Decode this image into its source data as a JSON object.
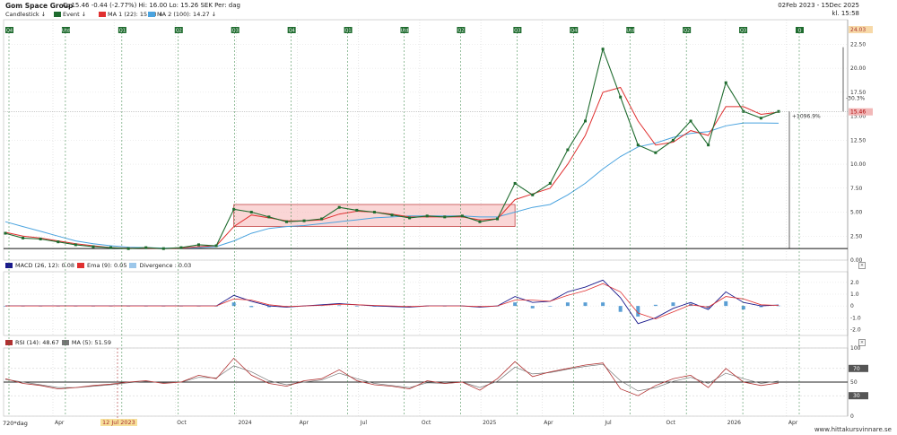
{
  "header": {
    "title": "Gom Space Group",
    "quote": "C: 15.46  -0.44 (-2.77%)   Hi: 16.00   Lo: 15.26   SEK   Per: dag",
    "date_range": "02Feb 2023 - 15Dec 2025",
    "updated": "kl. 15:58",
    "legend": [
      {
        "label": "Candlestick",
        "color": "#1e6b2e"
      },
      {
        "label": "Event",
        "color": "#1e6b2e"
      },
      {
        "label": "MA 1 (22): 15.43",
        "color": "#e03030"
      },
      {
        "label": "MA 2 (100): 14.27",
        "color": "#4aa3df"
      }
    ]
  },
  "panes": {
    "macd_legend": [
      {
        "label": "MACD (26, 12): 0.08",
        "color": "#1a1a8c"
      },
      {
        "label": "Ema (9): 0.05",
        "color": "#e03030"
      },
      {
        "label": "Divergence : 0.03",
        "color": "#9cc7ea"
      }
    ],
    "rsi_legend": [
      {
        "label": "RSI (14): 48.67",
        "color": "#b03030"
      },
      {
        "label": "MA (5): 51.59",
        "color": "#777777"
      }
    ]
  },
  "footer": {
    "period_label": "720*dag",
    "cursor_date": "12 Jul 2023",
    "credit": "www.hittakursvinnare.se"
  },
  "annotations": {
    "drop_pct": "-30.3%",
    "rise_pct": "+1096.9%",
    "current_price": "15.46",
    "top_price": "24.03"
  },
  "colors": {
    "candle_up": "#1e6b2e",
    "candle_down": "#1e6b2e",
    "ma1": "#e03030",
    "ma2": "#4aa3df",
    "range_box": "#f5b5b5",
    "event_marker": "#1e6b2e"
  },
  "chart_data": {
    "type": "line",
    "title": "Gom Space Group",
    "x_ticks": [
      "Apr",
      "Jul",
      "Oct",
      "2024",
      "Apr",
      "Jul",
      "Oct",
      "2025",
      "Apr",
      "Jul",
      "Oct",
      "2026",
      "Apr"
    ],
    "y_ticks": [
      0.0,
      2.5,
      5.0,
      7.5,
      10.0,
      12.5,
      15.0,
      17.5,
      20.0,
      22.5
    ],
    "ylim": [
      0,
      24.5
    ],
    "event_markers": [
      "Q4",
      "Utd",
      "Q1",
      "Q2",
      "Q3",
      "Q4",
      "Q1",
      "Utd",
      "Q2",
      "Q3",
      "Q4",
      "Utd",
      "Q2",
      "Q3",
      "Q"
    ],
    "price": [
      2.8,
      2.3,
      2.2,
      1.9,
      1.6,
      1.4,
      1.3,
      1.2,
      1.3,
      1.2,
      1.3,
      1.6,
      1.5,
      5.3,
      5.0,
      4.5,
      4.0,
      4.1,
      4.3,
      5.5,
      5.2,
      5.0,
      4.7,
      4.4,
      4.6,
      4.5,
      4.6,
      4.0,
      4.3,
      8.0,
      6.8,
      8.0,
      11.5,
      14.5,
      22.0,
      17.0,
      12.0,
      11.2,
      12.5,
      14.5,
      12.0,
      18.5,
      15.5,
      14.8,
      15.5
    ],
    "series": [
      {
        "name": "MA 1 (22)",
        "values": [
          2.9,
          2.5,
          2.3,
          2.0,
          1.7,
          1.5,
          1.3,
          1.25,
          1.25,
          1.2,
          1.25,
          1.4,
          1.5,
          3.5,
          4.7,
          4.4,
          4.1,
          4.1,
          4.2,
          4.8,
          5.1,
          5.0,
          4.8,
          4.5,
          4.5,
          4.5,
          4.5,
          4.2,
          4.3,
          6.3,
          6.9,
          7.5,
          10.0,
          13.0,
          17.5,
          18.0,
          14.5,
          12.0,
          12.3,
          13.5,
          13.0,
          16.0,
          16.0,
          15.2,
          15.43
        ]
      },
      {
        "name": "MA 2 (100)",
        "values": [
          4.0,
          3.5,
          3.0,
          2.5,
          2.0,
          1.7,
          1.5,
          1.35,
          1.3,
          1.25,
          1.25,
          1.3,
          1.4,
          2.0,
          2.8,
          3.3,
          3.5,
          3.6,
          3.8,
          4.0,
          4.2,
          4.4,
          4.5,
          4.6,
          4.6,
          4.6,
          4.6,
          4.5,
          4.5,
          5.0,
          5.5,
          5.8,
          6.8,
          8.0,
          9.5,
          10.8,
          11.8,
          12.2,
          12.8,
          13.2,
          13.4,
          14.0,
          14.3,
          14.3,
          14.27
        ]
      }
    ],
    "range_box": {
      "y": [
        3.5,
        5.8
      ]
    },
    "macd": {
      "yticks": [
        -2.0,
        -1.0,
        0,
        1.0,
        2.0
      ],
      "ylim": [
        -2.2,
        2.6
      ],
      "macd": [
        0,
        0,
        0,
        0,
        0,
        0,
        0,
        0,
        0,
        0,
        0,
        0,
        0,
        0.9,
        0.4,
        0.0,
        -0.1,
        0,
        0.1,
        0.2,
        0.1,
        0.0,
        -0.05,
        -0.1,
        0,
        0,
        0,
        -0.1,
        0,
        0.8,
        0.3,
        0.4,
        1.2,
        1.6,
        2.2,
        0.7,
        -1.5,
        -1.0,
        -0.2,
        0.3,
        -0.3,
        1.2,
        0.3,
        0,
        0.08
      ],
      "signal": [
        0,
        0,
        0,
        0,
        0,
        0,
        0,
        0,
        0,
        0,
        0,
        0,
        0,
        0.6,
        0.5,
        0.1,
        -0.05,
        0,
        0.05,
        0.15,
        0.1,
        0.05,
        0,
        -0.05,
        0,
        0,
        0,
        -0.05,
        0,
        0.5,
        0.5,
        0.4,
        0.9,
        1.3,
        1.9,
        1.2,
        -0.6,
        -1.1,
        -0.5,
        0.1,
        -0.1,
        0.8,
        0.6,
        0.1,
        0.05
      ]
    },
    "rsi": {
      "yticks": [
        0,
        30,
        50,
        70,
        100
      ],
      "ylim": [
        0,
        100
      ],
      "values": [
        55,
        48,
        45,
        40,
        42,
        45,
        47,
        50,
        52,
        48,
        50,
        60,
        55,
        85,
        60,
        48,
        44,
        52,
        55,
        68,
        52,
        46,
        44,
        40,
        52,
        48,
        50,
        38,
        55,
        80,
        58,
        65,
        70,
        75,
        78,
        40,
        30,
        45,
        55,
        60,
        42,
        70,
        50,
        45,
        48.67
      ],
      "ma": [
        54,
        50,
        46,
        42,
        42,
        44,
        46,
        49,
        51,
        49,
        50,
        57,
        56,
        74,
        65,
        52,
        46,
        50,
        53,
        63,
        55,
        48,
        45,
        42,
        49,
        48,
        50,
        42,
        51,
        72,
        62,
        64,
        69,
        73,
        76,
        52,
        37,
        42,
        51,
        57,
        48,
        63,
        55,
        48,
        51.59
      ]
    }
  }
}
